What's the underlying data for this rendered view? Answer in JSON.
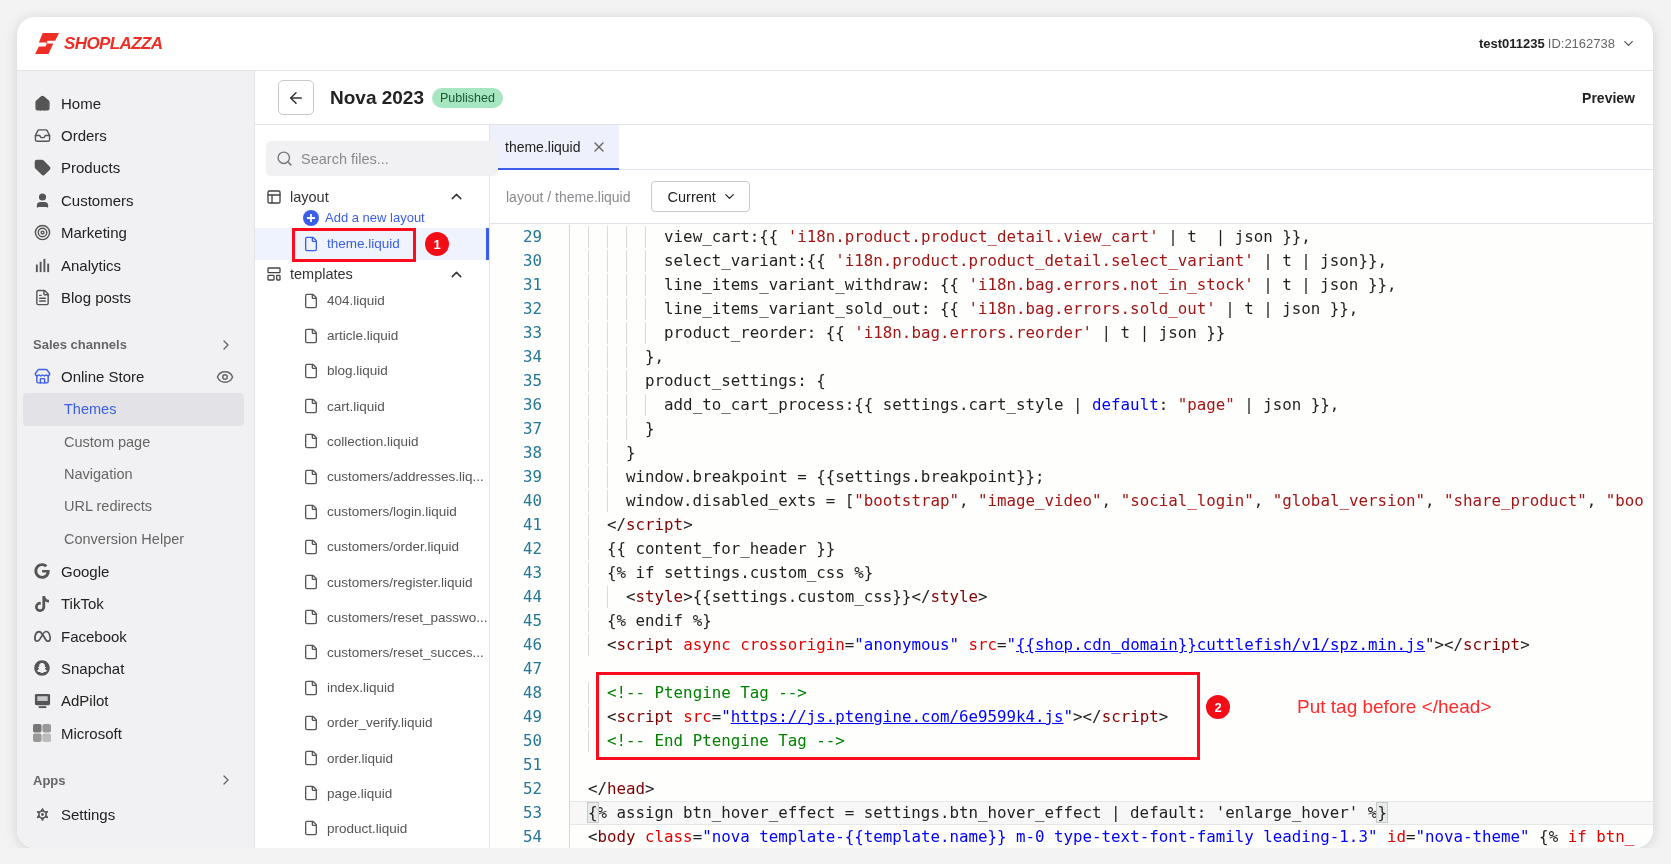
{
  "header": {
    "logo": "SHOPLAZZA",
    "account": {
      "name": "test011235",
      "id": "ID:2162738"
    }
  },
  "sidebar": {
    "main": [
      {
        "label": "Home",
        "selected": false
      },
      {
        "label": "Orders",
        "selected": false
      },
      {
        "label": "Products",
        "selected": false
      },
      {
        "label": "Customers",
        "selected": false
      },
      {
        "label": "Marketing",
        "selected": false
      },
      {
        "label": "Analytics",
        "selected": false
      },
      {
        "label": "Blog posts",
        "selected": false
      }
    ],
    "sales_channels": {
      "title": "Sales channels",
      "items": [
        {
          "label": "Online Store",
          "selected": false,
          "children": [
            {
              "label": "Themes",
              "selected": true
            },
            {
              "label": "Custom page",
              "selected": false
            },
            {
              "label": "Navigation",
              "selected": false
            },
            {
              "label": "URL redirects",
              "selected": false
            },
            {
              "label": "Conversion Helper",
              "selected": false
            }
          ]
        },
        {
          "label": "Google",
          "selected": false
        },
        {
          "label": "TikTok",
          "selected": false
        },
        {
          "label": "Facebook",
          "selected": false
        },
        {
          "label": "Snapchat",
          "selected": false
        },
        {
          "label": "AdPilot",
          "selected": false
        },
        {
          "label": "Microsoft",
          "selected": false
        }
      ]
    },
    "apps": {
      "title": "Apps"
    },
    "settings": {
      "label": "Settings",
      "selected": false
    }
  },
  "theme_bar": {
    "title": "Nova 2023",
    "status": "Published",
    "preview": "Preview"
  },
  "file_panel": {
    "search_placeholder": "Search files...",
    "folders": [
      {
        "name": "layout",
        "expanded": true,
        "add_label": "Add a new layout",
        "files": [
          {
            "name": "theme.liquid",
            "selected": true,
            "annotation": "1"
          }
        ]
      },
      {
        "name": "templates",
        "expanded": true,
        "files": [
          {
            "name": "404.liquid",
            "selected": false
          },
          {
            "name": "article.liquid",
            "selected": false
          },
          {
            "name": "blog.liquid",
            "selected": false
          },
          {
            "name": "cart.liquid",
            "selected": false
          },
          {
            "name": "collection.liquid",
            "selected": false
          },
          {
            "name": "customers/addresses.liq...",
            "selected": false
          },
          {
            "name": "customers/login.liquid",
            "selected": false
          },
          {
            "name": "customers/order.liquid",
            "selected": false
          },
          {
            "name": "customers/register.liquid",
            "selected": false
          },
          {
            "name": "customers/reset_passwo...",
            "selected": false
          },
          {
            "name": "customers/reset_succes...",
            "selected": false
          },
          {
            "name": "index.liquid",
            "selected": false
          },
          {
            "name": "order_verify.liquid",
            "selected": false
          },
          {
            "name": "order.liquid",
            "selected": false
          },
          {
            "name": "page.liquid",
            "selected": false
          },
          {
            "name": "product.liquid",
            "selected": false
          }
        ]
      }
    ]
  },
  "editor": {
    "tabs": [
      {
        "label": "theme.liquid",
        "selected": true
      }
    ],
    "breadcrumb": "layout / theme.liquid",
    "version": "Current",
    "code": [
      {
        "number": "29",
        "current": false,
        "tokens": [
          {
            "kind": "plain",
            "text": "        view_cart:{{ "
          },
          {
            "kind": "str",
            "text": "'i18n.product.product_detail.view_cart'"
          },
          {
            "kind": "plain",
            "text": " | t  | json }},"
          }
        ]
      },
      {
        "number": "30",
        "current": false,
        "tokens": [
          {
            "kind": "plain",
            "text": "        select_variant:{{ "
          },
          {
            "kind": "str",
            "text": "'i18n.product.product_detail.select_variant'"
          },
          {
            "kind": "plain",
            "text": " | t | json}},"
          }
        ]
      },
      {
        "number": "31",
        "current": false,
        "tokens": [
          {
            "kind": "plain",
            "text": "        line_items_variant_withdraw: {{ "
          },
          {
            "kind": "str",
            "text": "'i18n.bag.errors.not_in_stock'"
          },
          {
            "kind": "plain",
            "text": " | t | json }},"
          }
        ]
      },
      {
        "number": "32",
        "current": false,
        "tokens": [
          {
            "kind": "plain",
            "text": "        line_items_variant_sold_out: {{ "
          },
          {
            "kind": "str",
            "text": "'i18n.bag.errors.sold_out'"
          },
          {
            "kind": "plain",
            "text": " | t | json }},"
          }
        ]
      },
      {
        "number": "33",
        "current": false,
        "tokens": [
          {
            "kind": "plain",
            "text": "        product_reorder: {{ "
          },
          {
            "kind": "str",
            "text": "'i18n.bag.errors.reorder'"
          },
          {
            "kind": "plain",
            "text": " | t | json }}"
          }
        ]
      },
      {
        "number": "34",
        "current": false,
        "tokens": [
          {
            "kind": "plain",
            "text": "      },"
          }
        ]
      },
      {
        "number": "35",
        "current": false,
        "tokens": [
          {
            "kind": "plain",
            "text": "      product_settings: {"
          }
        ]
      },
      {
        "number": "36",
        "current": false,
        "tokens": [
          {
            "kind": "plain",
            "text": "        add_to_cart_process:{{ settings.cart_style | "
          },
          {
            "kind": "kw",
            "text": "default"
          },
          {
            "kind": "plain",
            "text": ": "
          },
          {
            "kind": "str",
            "text": "\"page\""
          },
          {
            "kind": "plain",
            "text": " | json }},"
          }
        ]
      },
      {
        "number": "37",
        "current": false,
        "tokens": [
          {
            "kind": "plain",
            "text": "      }"
          }
        ]
      },
      {
        "number": "38",
        "current": false,
        "tokens": [
          {
            "kind": "plain",
            "text": "    }"
          }
        ]
      },
      {
        "number": "39",
        "current": false,
        "tokens": [
          {
            "kind": "plain",
            "text": "    window.breakpoint = {{settings.breakpoint}};"
          }
        ]
      },
      {
        "number": "40",
        "current": false,
        "tokens": [
          {
            "kind": "plain",
            "text": "    window.disabled_exts = ["
          },
          {
            "kind": "str",
            "text": "\"bootstrap\""
          },
          {
            "kind": "plain",
            "text": ", "
          },
          {
            "kind": "str",
            "text": "\"image_video\""
          },
          {
            "kind": "plain",
            "text": ", "
          },
          {
            "kind": "str",
            "text": "\"social_login\""
          },
          {
            "kind": "plain",
            "text": ", "
          },
          {
            "kind": "str",
            "text": "\"global_version\""
          },
          {
            "kind": "plain",
            "text": ", "
          },
          {
            "kind": "str",
            "text": "\"share_product\""
          },
          {
            "kind": "plain",
            "text": ", "
          },
          {
            "kind": "str",
            "text": "\"boo"
          }
        ]
      },
      {
        "number": "41",
        "current": false,
        "tokens": [
          {
            "kind": "plain",
            "text": "  </"
          },
          {
            "kind": "tag",
            "text": "script"
          },
          {
            "kind": "plain",
            "text": ">"
          }
        ]
      },
      {
        "number": "42",
        "current": false,
        "tokens": [
          {
            "kind": "plain",
            "text": "  {{ content_for_header }}"
          }
        ]
      },
      {
        "number": "43",
        "current": false,
        "tokens": [
          {
            "kind": "plain",
            "text": "  {% if settings.custom_css %}"
          }
        ]
      },
      {
        "number": "44",
        "current": false,
        "tokens": [
          {
            "kind": "plain",
            "text": "    <"
          },
          {
            "kind": "tag",
            "text": "style"
          },
          {
            "kind": "plain",
            "text": ">{{settings.custom_css}}</"
          },
          {
            "kind": "tag",
            "text": "style"
          },
          {
            "kind": "plain",
            "text": ">"
          }
        ]
      },
      {
        "number": "45",
        "current": false,
        "tokens": [
          {
            "kind": "plain",
            "text": "  {% endif %}"
          }
        ]
      },
      {
        "number": "46",
        "current": false,
        "tokens": [
          {
            "kind": "plain",
            "text": "  <"
          },
          {
            "kind": "tag",
            "text": "script"
          },
          {
            "kind": "attr",
            "text": " async"
          },
          {
            "kind": "attr",
            "text": " crossorigin"
          },
          {
            "kind": "plain",
            "text": "="
          },
          {
            "kind": "val",
            "text": "\"anonymous\""
          },
          {
            "kind": "attr",
            "text": " src"
          },
          {
            "kind": "plain",
            "text": "="
          },
          {
            "kind": "val",
            "text": "\""
          },
          {
            "kind": "link",
            "text": "{{shop.cdn_domain}}cuttlefish/v1/spz.min.js"
          },
          {
            "kind": "plain",
            "text": "\"></"
          },
          {
            "kind": "tag",
            "text": "script"
          },
          {
            "kind": "plain",
            "text": ">"
          }
        ]
      },
      {
        "number": "47",
        "current": false
      },
      {
        "kind": "group",
        "annotation": "2",
        "note": "Put tag before </head>",
        "lines": [
          {
            "number": "48",
            "current": false,
            "tokens": [
              {
                "kind": "comment",
                "text": "  <!-- Ptengine Tag -->"
              }
            ]
          },
          {
            "number": "49",
            "current": false,
            "tokens": [
              {
                "kind": "plain",
                "text": "  <"
              },
              {
                "kind": "tag",
                "text": "script"
              },
              {
                "kind": "attr",
                "text": " src"
              },
              {
                "kind": "plain",
                "text": "="
              },
              {
                "kind": "val",
                "text": "\""
              },
              {
                "kind": "link",
                "text": "https://js.ptengine.com/6e9599k4.js"
              },
              {
                "kind": "val",
                "text": "\""
              },
              {
                "kind": "plain",
                "text": "></"
              },
              {
                "kind": "tag",
                "text": "script"
              },
              {
                "kind": "plain",
                "text": ">"
              }
            ]
          },
          {
            "number": "50",
            "current": false,
            "tokens": [
              {
                "kind": "comment",
                "text": "  <!-- End Ptengine Tag -->"
              }
            ]
          }
        ]
      },
      {
        "number": "51",
        "current": false
      },
      {
        "number": "52",
        "current": false,
        "tokens": [
          {
            "kind": "plain",
            "text": "</"
          },
          {
            "kind": "tag",
            "text": "head"
          },
          {
            "kind": "plain",
            "text": ">"
          }
        ]
      },
      {
        "number": "53",
        "current": true,
        "tokens": [
          {
            "kind": "bracket",
            "text": "{"
          },
          {
            "kind": "plain",
            "text": "% assign btn_hover_effect = settings.btn_hover_effect | default: 'enlarge_hover' %"
          },
          {
            "kind": "bracket",
            "text": "}"
          }
        ]
      },
      {
        "number": "54",
        "current": false,
        "tokens": [
          {
            "kind": "plain",
            "text": "<"
          },
          {
            "kind": "tag",
            "text": "body"
          },
          {
            "kind": "attr",
            "text": " class"
          },
          {
            "kind": "plain",
            "text": "="
          },
          {
            "kind": "val",
            "text": "\"nova template-{{template.name}} m-0 type-text-font-family leading-1.3\""
          },
          {
            "kind": "attr",
            "text": " id"
          },
          {
            "kind": "plain",
            "text": "="
          },
          {
            "kind": "val",
            "text": "\"nova-theme\""
          },
          {
            "kind": "plain",
            "text": " {% "
          },
          {
            "kind": "attr",
            "text": "if btn_"
          }
        ]
      }
    ]
  }
}
